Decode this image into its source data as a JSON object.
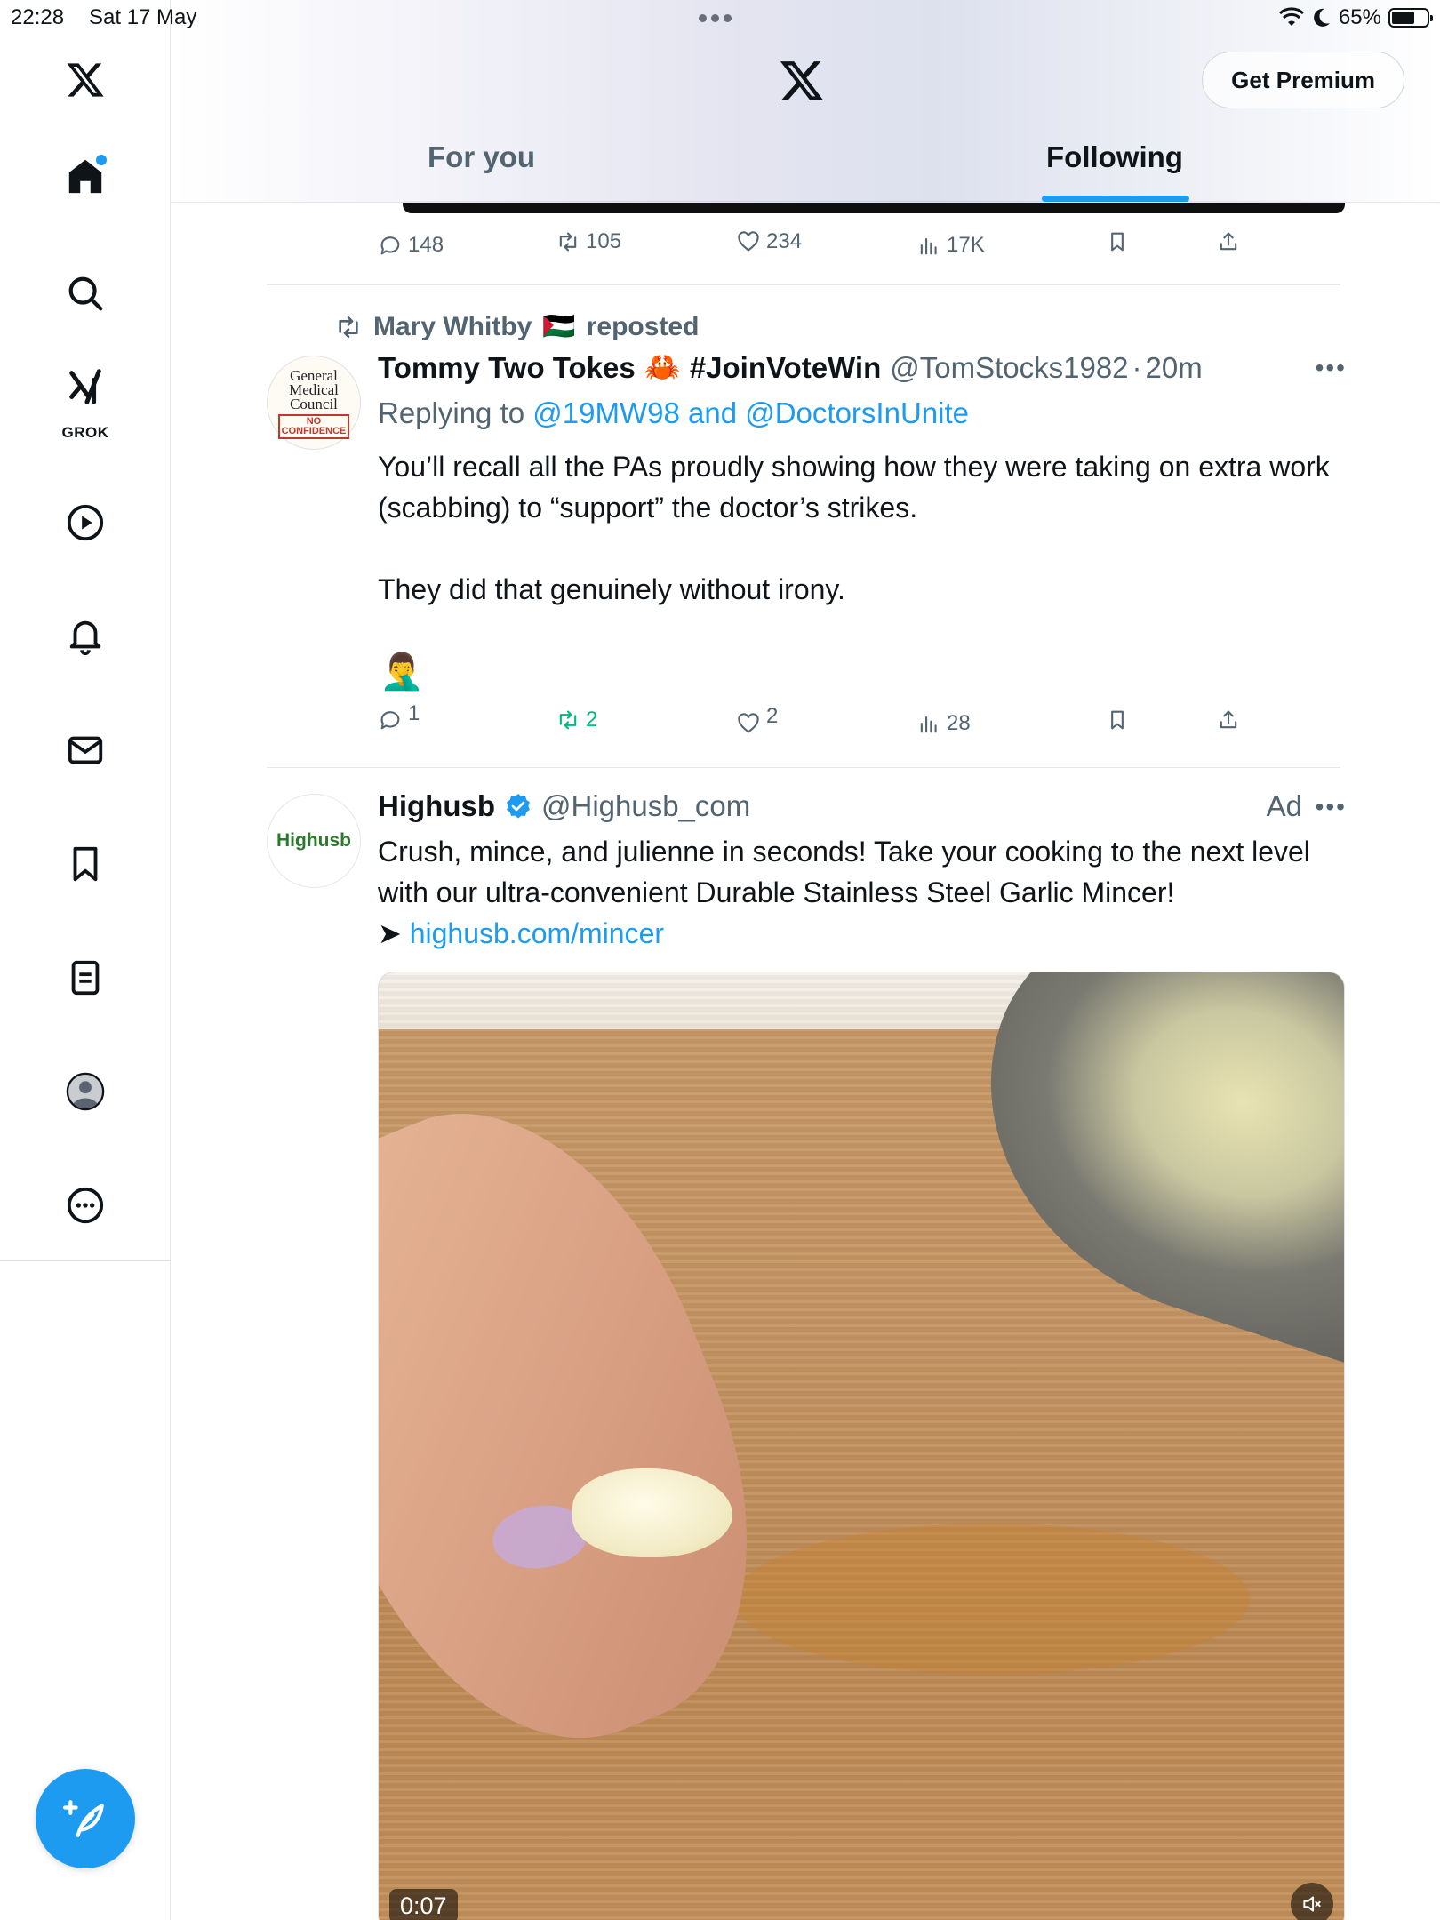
{
  "status_bar": {
    "time": "22:28",
    "date": "Sat 17 May",
    "battery": "65%",
    "battery_level": 0.65
  },
  "sidebar": {
    "items": [
      {
        "name": "home",
        "icon": "home-icon"
      },
      {
        "name": "explore",
        "icon": "search-icon"
      },
      {
        "name": "grok",
        "icon": "grok-icon",
        "label": "GROK"
      },
      {
        "name": "video",
        "icon": "play-icon"
      },
      {
        "name": "notifications",
        "icon": "bell-icon"
      },
      {
        "name": "messages",
        "icon": "mail-icon"
      },
      {
        "name": "bookmarks",
        "icon": "bookmark-icon"
      },
      {
        "name": "lists",
        "icon": "list-icon"
      },
      {
        "name": "profile",
        "icon": "avatar-icon"
      },
      {
        "name": "more",
        "icon": "more-circle-icon"
      }
    ],
    "compose_icon": "compose-feather-icon"
  },
  "header": {
    "premium_label": "Get Premium",
    "tabs": [
      {
        "label": "For you",
        "selected": false
      },
      {
        "label": "Following",
        "selected": true
      }
    ]
  },
  "feed": {
    "prev_tweet_actions": {
      "replies": "148",
      "reposts": "105",
      "likes": "234",
      "views": "17K"
    },
    "tweet1": {
      "reposted_by": "Mary Whitby",
      "reposted_flag": "🇵🇸",
      "reposted_label": "reposted",
      "avatar_text": [
        "General",
        "Medical",
        "Council"
      ],
      "avatar_badge": [
        "NO",
        "CONFIDENCE"
      ],
      "display_name": "Tommy Two Tokes",
      "name_emoji": "🦀",
      "name_hashtag": "#JoinVoteWin",
      "handle": "@TomStocks1982",
      "dot": "·",
      "time": "20m",
      "replying_prefix": "Replying to",
      "replying_to": "@19MW98 and @DoctorsInUnite",
      "body_1": "You’ll recall all the PAs proudly showing how they were taking on extra work (scabbing) to “support” the doctor’s strikes.",
      "body_2": "They did that genuinely without irony.",
      "emoji": "🤦‍♂️",
      "replies": "1",
      "reposts": "2",
      "likes": "2",
      "views": "28"
    },
    "tweet2": {
      "avatar_text": "Highusb",
      "display_name": "Highusb",
      "handle": "@Highusb_com",
      "ad_label": "Ad",
      "body": "Crush, mince, and julienne in seconds!  Take your cooking to the next level with our ultra-convenient Durable Stainless Steel Garlic Mincer!",
      "link_arrow": "➤",
      "link": "highusb.com/mincer",
      "video_time": "0:07"
    }
  },
  "colors": {
    "accent": "#1d9bf0",
    "repost_green": "#00ba7c",
    "secondary_text": "#536471"
  }
}
